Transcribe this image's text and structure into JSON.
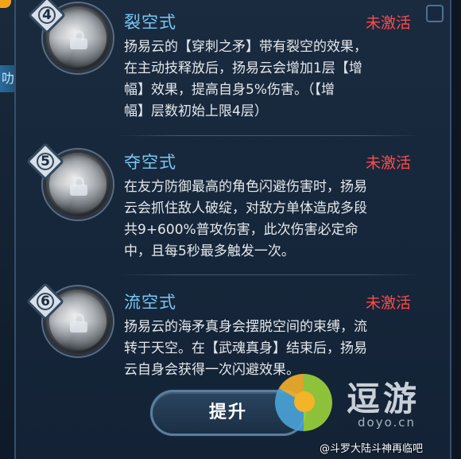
{
  "side_tab": {
    "label": "叻雪、"
  },
  "skills": [
    {
      "number": "4",
      "title": "裂空式",
      "status": "未激活",
      "lines": [
        "扬易云的【穿刺之矛】带有裂空的效果，",
        "在主动技释放后，扬易云会增加1层【增",
        "幅】效果，提高自身5%伤害。（【增",
        "幅】层数初始上限4层）"
      ]
    },
    {
      "number": "5",
      "title": "夺空式",
      "status": "未激活",
      "lines": [
        "在友方防御最高的角色闪避伤害时，扬易",
        "云会抓住敌人破绽，对敌方单体造成多段",
        "共9+600%普攻伤害，此次伤害必定命",
        "中，且每5秒最多触发一次。"
      ]
    },
    {
      "number": "6",
      "title": "流空式",
      "status": "未激活",
      "lines": [
        "扬易云的海矛真身会摆脱空间的束缚，流",
        "转于天空。在【武魂真身】结束后，扬易",
        "云自身会获得一次闪避效果。"
      ]
    }
  ],
  "upgrade_button": {
    "label": "提升"
  },
  "logo": {
    "name": "逗游",
    "site": "doyo.cn"
  },
  "watermark": {
    "text": "@斗罗大陆斗神再临吧"
  },
  "colors": {
    "title": "#78c8f4",
    "status": "#ff4a4a",
    "text": "#e4e8ec",
    "panel": "#16263a"
  }
}
